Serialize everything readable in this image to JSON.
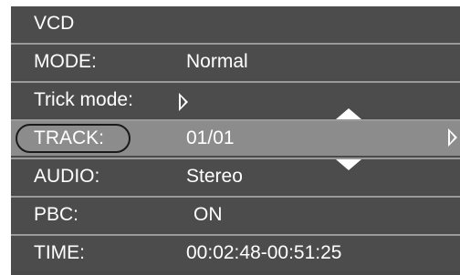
{
  "title": "VCD",
  "rows": [
    {
      "label": "MODE:",
      "value": "Normal"
    },
    {
      "label": "Trick mode:",
      "value": ""
    },
    {
      "label": "TRACK:",
      "value": "01/01"
    },
    {
      "label": "AUDIO:",
      "value": "Stereo"
    },
    {
      "label": "PBC:",
      "value": "ON"
    },
    {
      "label": "TIME:",
      "value": "00:02:48-00:51:25"
    }
  ],
  "icons": {
    "trick_arrow": "right-triangle-icon",
    "up_arrow": "up-triangle-icon",
    "down_arrow": "down-triangle-icon",
    "track_next": "right-triangle-icon"
  },
  "colors": {
    "panel": "#4c4c4c",
    "highlight": "#8c8c8c",
    "divider": "#9a9a9a",
    "text": "#ffffff"
  }
}
